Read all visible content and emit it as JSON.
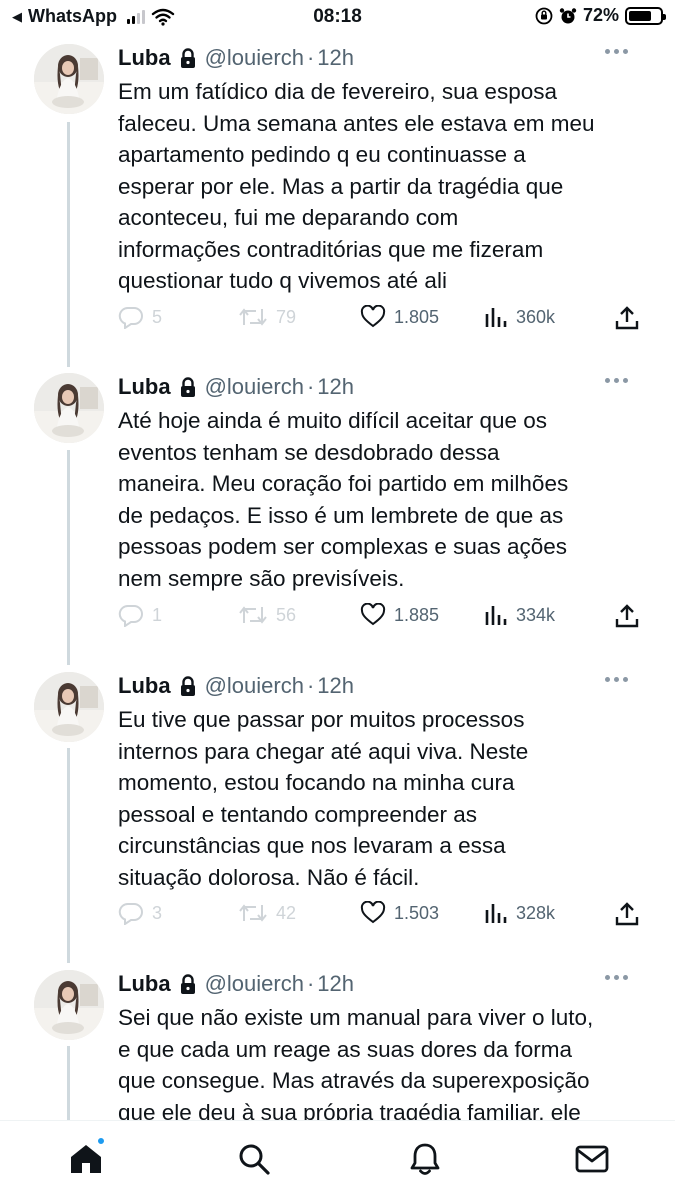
{
  "status_bar": {
    "back_app": "WhatsApp",
    "time": "08:18",
    "battery": "72%",
    "battery_level": 0.72
  },
  "tweets": [
    {
      "name": "Luba",
      "handle": "@louierch",
      "time": "12h",
      "text": "Em um fatídico dia de fevereiro, sua esposa\nfaleceu. Uma semana antes ele estava em meu\napartamento pedindo q eu continuasse a\nesperar por ele. Mas a partir da tragédia que\naconteceu, fui me deparando com\ninformações contraditórias que me fizeram\nquestionar tudo q vivemos até ali",
      "replies": "5",
      "retweets": "79",
      "likes": "1.805",
      "views": "360k"
    },
    {
      "name": "Luba",
      "handle": "@louierch",
      "time": "12h",
      "text": "Até hoje ainda é muito difícil aceitar que os\neventos tenham se desdobrado dessa\nmaneira. Meu coração foi partido em milhões\nde pedaços. E isso é um lembrete de que as\npessoas podem ser complexas e suas ações\nnem sempre são previsíveis.",
      "replies": "1",
      "retweets": "56",
      "likes": "1.885",
      "views": "334k"
    },
    {
      "name": "Luba",
      "handle": "@louierch",
      "time": "12h",
      "text": "Eu tive que passar por muitos processos\ninternos para chegar até aqui viva. Neste\nmomento, estou focando na minha cura\npessoal e tentando compreender as\ncircunstâncias que nos levaram a essa\nsituação dolorosa. Não é fácil.",
      "replies": "3",
      "retweets": "42",
      "likes": "1.503",
      "views": "328k"
    },
    {
      "name": "Luba",
      "handle": "@louierch",
      "time": "12h",
      "text": "Sei que não existe um manual para viver o luto,\ne que cada um reage as suas dores da forma\nque consegue. Mas através da superexposição\nque ele deu à sua própria tragédia familiar, ele"
    }
  ],
  "tweet_dot": "·",
  "icons": {
    "lock": "lock-icon",
    "more": "more-icon",
    "reply": "reply-icon",
    "retweet": "retweet-icon",
    "like": "heart-icon",
    "views": "views-icon",
    "share": "share-icon",
    "nav": [
      "home-icon",
      "search-icon",
      "bell-icon",
      "mail-icon"
    ]
  },
  "colors": {
    "text": "#0f1419",
    "secondary": "#536471",
    "faded": "#cfd4d8",
    "accent": "#1d9bf0",
    "thread_line": "#cfd9de"
  }
}
